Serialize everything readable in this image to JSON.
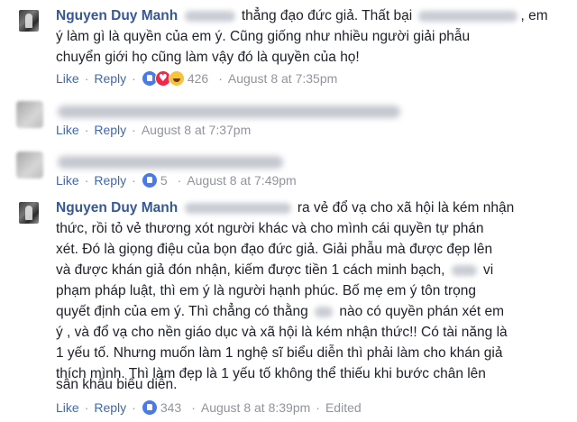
{
  "comments": [
    {
      "author": "Nguyen Duy Manh",
      "lines": [
        "thẳng đạo đức giả. Thất bại",
        ", em",
        "ý làm gì là quyền của em ý. Cũng giống như nhiều người giải phẫu",
        "chuyển giới họ cũng làm vậy đó là quyền của họ!"
      ],
      "like": "Like",
      "reply": "Reply",
      "reaction_count": "426",
      "time": "August 8 at 7:35pm"
    },
    {
      "like": "Like",
      "reply": "Reply",
      "time": "August 8 at 7:37pm"
    },
    {
      "like": "Like",
      "reply": "Reply",
      "reaction_count": "5",
      "time": "August 8 at 7:49pm"
    },
    {
      "author": "Nguyen Duy Manh",
      "lines": [
        "ra vẻ đổ vạ cho xã hội là kém nhận",
        "thức, rồi tỏ vẻ thương xót người khác và cho mình cái quyền tự phán",
        "xét. Đó là giọng điệu của bọn đạo đức giả. Giải phẫu mà được đẹp lên",
        "và được khán giả đón nhận, kiếm được tiền 1 cách minh bạch,",
        "vi",
        "phạm pháp luật, thì em ý là người hạnh phúc. Bố mẹ em ý tôn trọng",
        "quyết định của em ý. Thì chẳng có thằng",
        "nào có quyền phán xét em",
        "ý , và đổ vạ cho nền giáo dục và xã hội là kém nhận thức!! Có tài năng là",
        "1 yếu tố. Nhưng muốn làm 1 nghệ sĩ biểu diễn thì phải làm cho khán giả",
        "thích mình. Thì làm đẹp là 1 yếu tố không thể thiếu khi bước chân lên",
        "sân khấu biểu diễn."
      ],
      "like": "Like",
      "reply": "Reply",
      "reaction_count": "343",
      "time": "August 8 at 8:39pm",
      "edited": "Edited"
    }
  ],
  "separator": "·",
  "colors": {
    "name": "#365899",
    "link": "#4267b2",
    "meta": "#90949c",
    "text": "#1d2129",
    "like_reaction": "#4a7ae6",
    "love_reaction": "#f0284a",
    "haha_reaction": "#f7c33c"
  }
}
